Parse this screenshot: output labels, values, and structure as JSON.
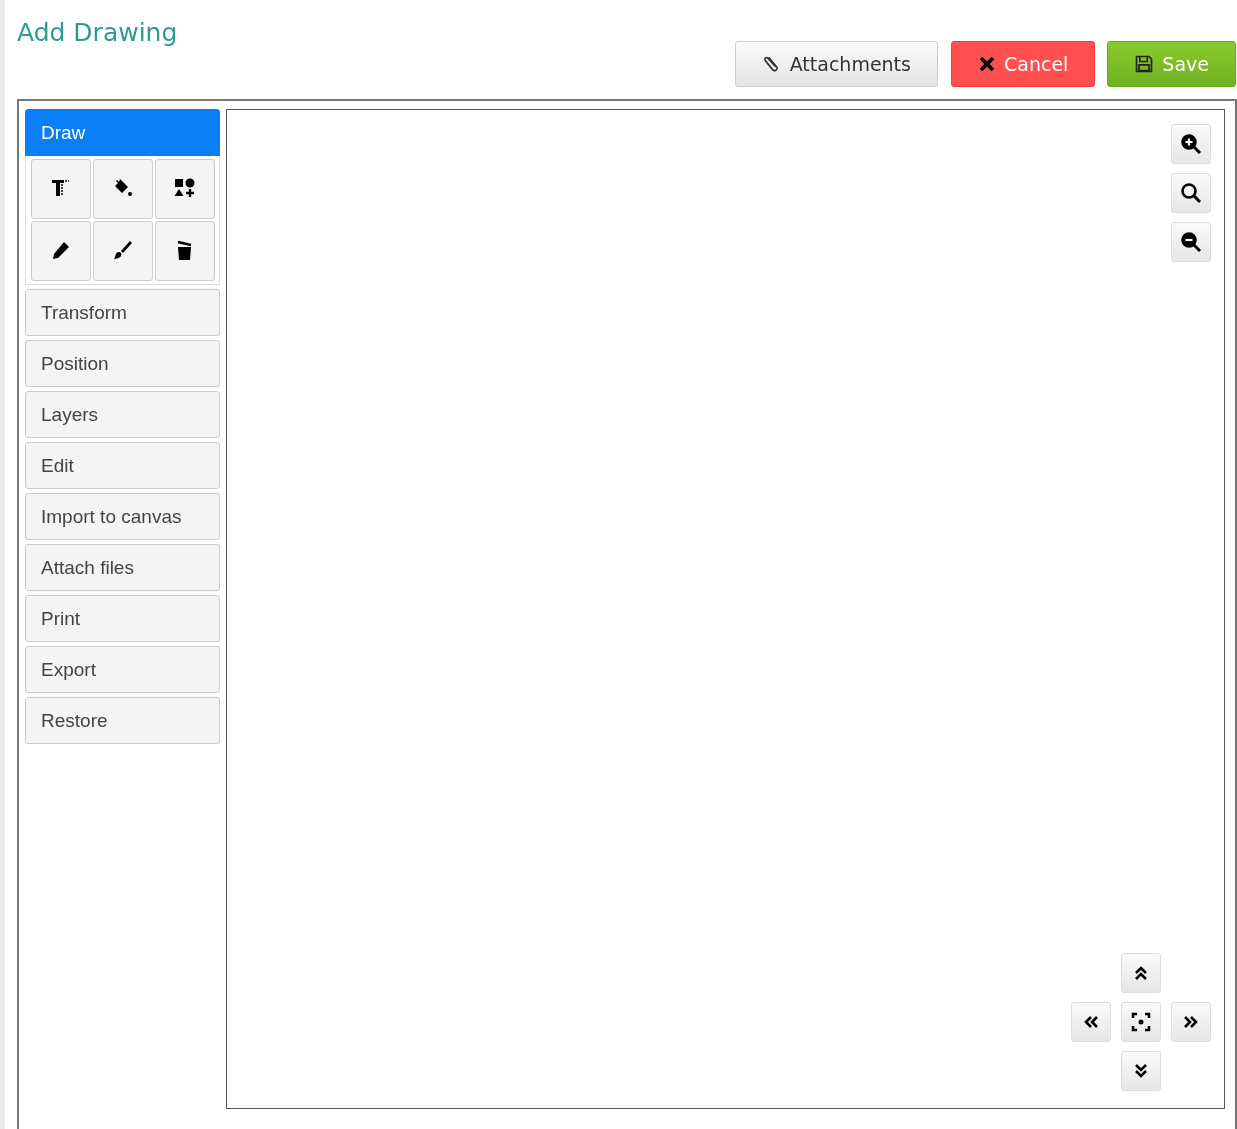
{
  "title": "Add Drawing",
  "actions": [
    {
      "kind": "attach",
      "label": "Attachments"
    },
    {
      "kind": "cancel",
      "label": "Cancel"
    },
    {
      "kind": "save",
      "label": "Save"
    }
  ],
  "menu": [
    {
      "label": "Draw",
      "selected": true
    },
    {
      "label": "Transform",
      "selected": false
    },
    {
      "label": "Position",
      "selected": false
    },
    {
      "label": "Layers",
      "selected": false
    },
    {
      "label": "Edit",
      "selected": false
    },
    {
      "label": "Import to canvas",
      "selected": false
    },
    {
      "label": "Attach files",
      "selected": false
    },
    {
      "label": "Print",
      "selected": false
    },
    {
      "label": "Export",
      "selected": false
    },
    {
      "label": "Restore",
      "selected": false
    }
  ]
}
